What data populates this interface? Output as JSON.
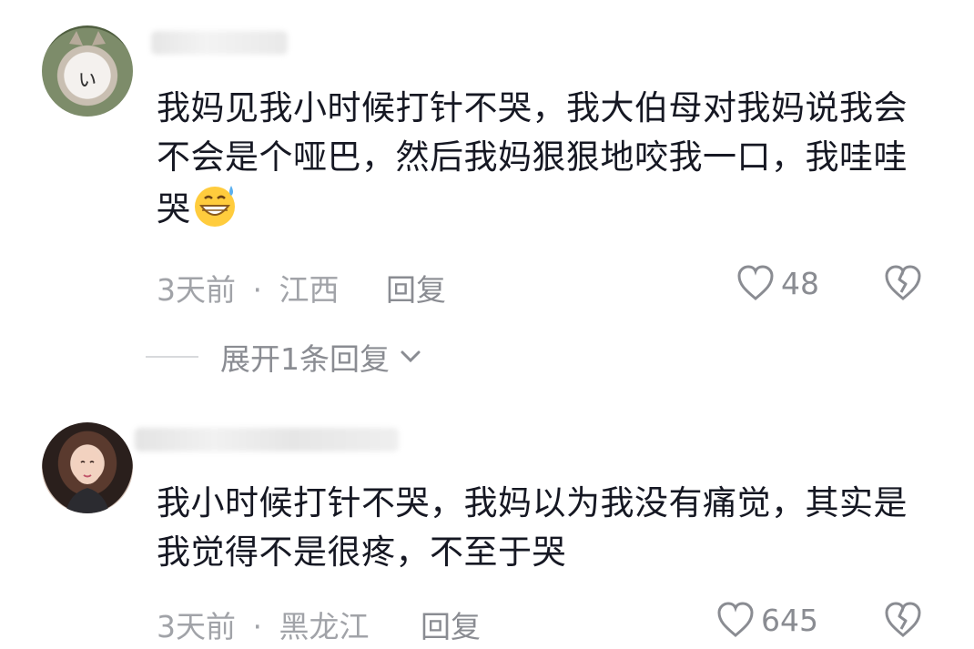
{
  "comments": [
    {
      "text": "我妈见我小时候打针不哭，我大伯母对我妈说我会不会是个哑巴，然后我妈狠狠地咬我一口，我哇哇哭",
      "emoji": "grinning-sweat-emoji",
      "time": "3天前",
      "separator": "·",
      "location": "江西",
      "reply_label": "回复",
      "likes": "48",
      "expand_label": "展开1条回复"
    },
    {
      "text": "我小时候打针不哭，我妈以为我没有痛觉，其实是我觉得不是很疼，不至于哭",
      "time": "3天前",
      "separator": "·",
      "location": "黑龙江",
      "reply_label": "回复",
      "likes": "645"
    }
  ],
  "icons": {
    "like": "heart-icon",
    "dislike": "broken-heart-icon",
    "expand": "chevron-down-icon"
  },
  "colors": {
    "text": "#161823",
    "meta": "#a1a3a8",
    "icon": "#8a8c92"
  }
}
